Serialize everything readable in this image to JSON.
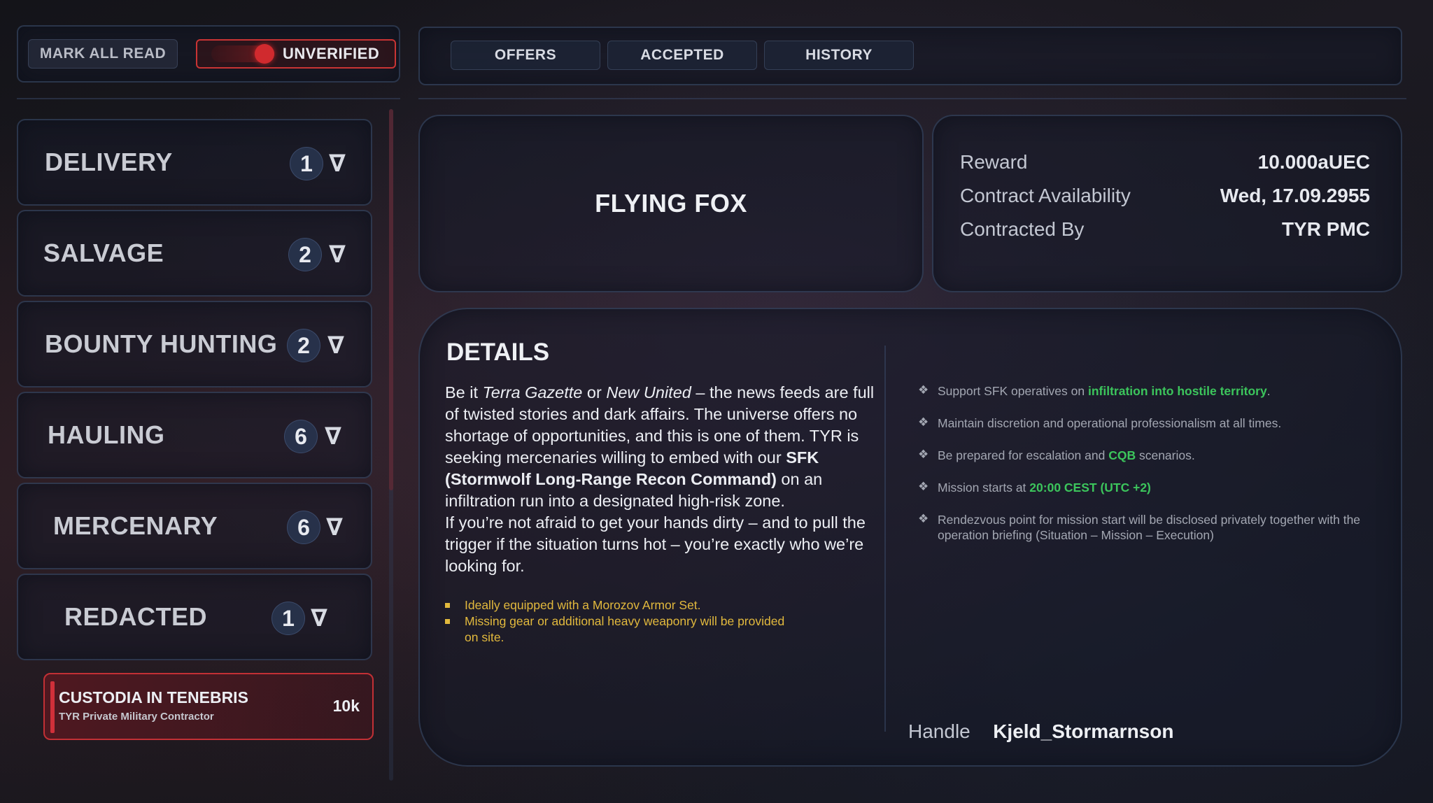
{
  "toolbar": {
    "mark_all_read": "MARK ALL READ",
    "unverified": "UNVERIFIED",
    "unverified_on": true
  },
  "tabs": [
    {
      "label": "OFFERS"
    },
    {
      "label": "ACCEPTED"
    },
    {
      "label": "HISTORY"
    }
  ],
  "categories": [
    {
      "label": "DELIVERY",
      "count": "1"
    },
    {
      "label": "SALVAGE",
      "count": "2"
    },
    {
      "label": "BOUNTY HUNTING",
      "count": "2"
    },
    {
      "label": "HAULING",
      "count": "6"
    },
    {
      "label": "MERCENARY",
      "count": "6"
    },
    {
      "label": "REDACTED",
      "count": "1"
    }
  ],
  "chevron_glyph": "∇",
  "selected_contract": {
    "title": "CUSTODIA IN TENEBRIS",
    "subtitle": "TYR Private Military Contractor",
    "reward_short": "10k"
  },
  "mission": {
    "title": "FLYING FOX"
  },
  "info": {
    "reward_label": "Reward",
    "reward_value": "10.000aUEC",
    "availability_label": "Contract Availability",
    "availability_value": "Wed, 17.09.2955",
    "contracted_by_label": "Contracted By",
    "contracted_by_value": "TYR PMC"
  },
  "details": {
    "heading": "DETAILS",
    "p1_a": "Be it ",
    "p1_b": "Terra Gazette",
    "p1_c": " or ",
    "p1_d": "New United",
    "p1_e": " – the news feeds are full of twisted stories and dark affairs. The universe offers no shortage of opportunities, and this is one of them. TYR is seeking mercenaries willing to embed with our ",
    "p1_f": "SFK (Stormwolf Long-Range Recon Command)",
    "p1_g": " on an infiltration run into a designated high-risk zone.",
    "p2": "If you’re not afraid to get your hands dirty – and to pull the trigger if the situation turns hot – you’re exactly who we’re looking for.",
    "gear": [
      "Ideally equipped with a Morozov Armor Set.",
      "Missing gear or additional heavy weaponry will be provided on site."
    ],
    "objectives": {
      "o1_a": "Support SFK operatives on ",
      "o1_b": "infiltration into hostile territory",
      "o1_c": ".",
      "o2": "Maintain discretion and operational professionalism at all times.",
      "o3_a": "Be prepared for escalation and ",
      "o3_b": "CQB",
      "o3_c": " scenarios.",
      "o4_a": "Mission starts at ",
      "o4_b": "20:00 CEST (UTC +2)",
      "o5": "Rendezvous point for mission start will be disclosed privately together with the operation briefing (Situation – Mission – Execution)"
    },
    "bullet_glyph": "❖",
    "handle_label": "Handle",
    "handle_value": "Kjeld_Stormarnson"
  },
  "colors": {
    "accent_red": "#c93434",
    "highlight_green": "#3cc55c",
    "gear_yellow": "#e2b93d"
  }
}
